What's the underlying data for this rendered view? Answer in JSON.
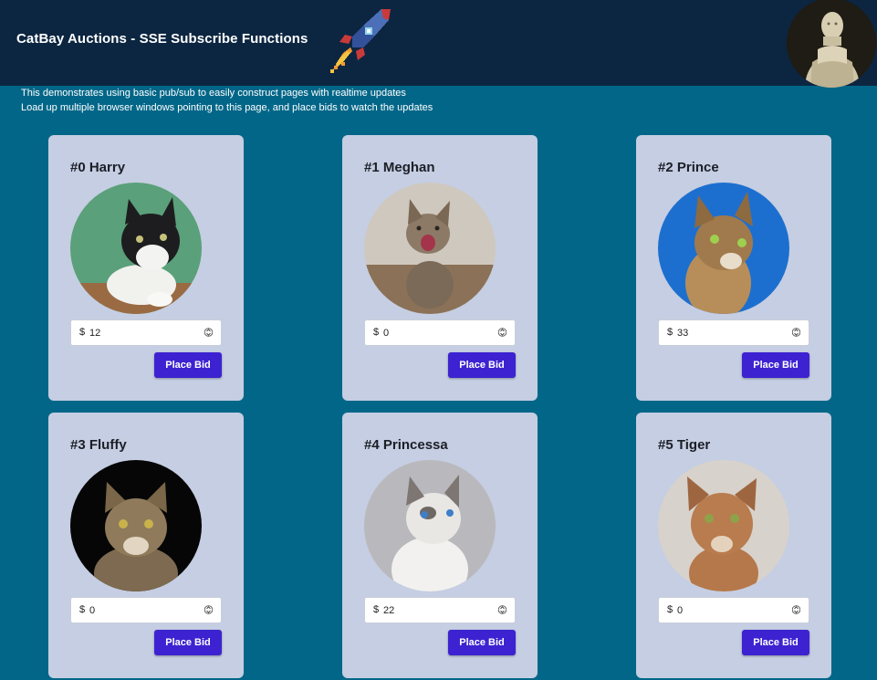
{
  "header": {
    "title": "CatBay Auctions - SSE Subscribe Functions",
    "rocket_icon": "rocket-icon",
    "avatar": "user-avatar"
  },
  "intro": {
    "line1": "This demonstrates using basic pub/sub to easily construct pages with realtime updates",
    "line2": "Load up multiple browser windows pointing to this page, and place bids to watch the updates"
  },
  "cards": [
    {
      "name": "#0 Harry",
      "currency": "$",
      "bid": "12",
      "button": "Place Bid"
    },
    {
      "name": "#1 Meghan",
      "currency": "$",
      "bid": "0",
      "button": "Place Bid"
    },
    {
      "name": "#2 Prince",
      "currency": "$",
      "bid": "33",
      "button": "Place Bid"
    },
    {
      "name": "#3 Fluffy",
      "currency": "$",
      "bid": "0",
      "button": "Place Bid"
    },
    {
      "name": "#4 Princessa",
      "currency": "$",
      "bid": "22",
      "button": "Place Bid"
    },
    {
      "name": "#5 Tiger",
      "currency": "$",
      "bid": "0",
      "button": "Place Bid"
    }
  ],
  "colors": {
    "header_bg": "#0c2641",
    "page_bg": "#026688",
    "card_bg": "#c5cee2",
    "button_bg": "#3d22d1"
  }
}
